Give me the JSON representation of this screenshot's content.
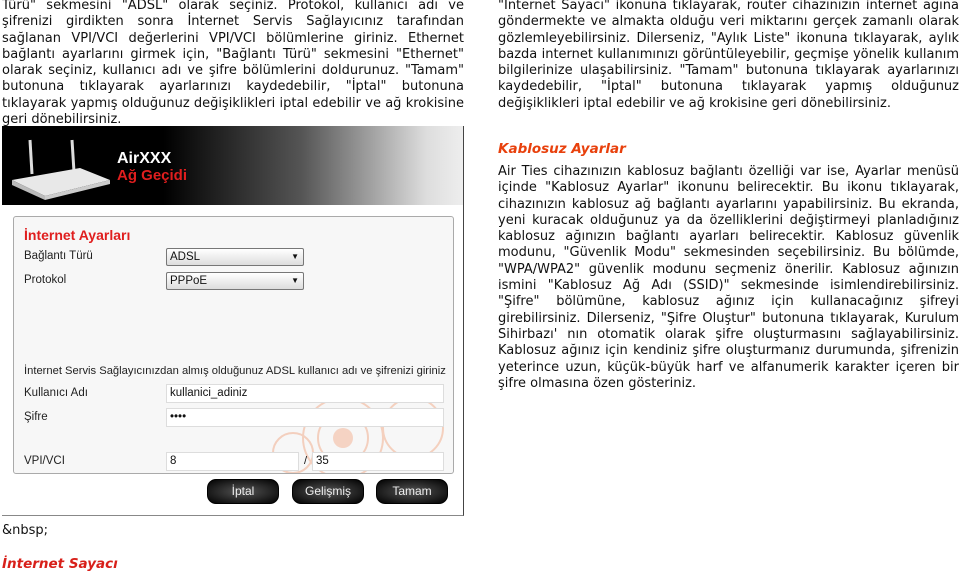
{
  "left_column": {
    "paragraph": "Türü\" sekmesini \"ADSL\" olarak seçiniz. Protokol, kullanıcı adı ve şifrenizi girdikten sonra İnternet Servis Sağlayıcınız tarafından sağlanan VPI/VCI değerlerini VPI/VCI bölümlerine giriniz. Ethernet bağlantı ayarlarını girmek için, \"Bağlantı Türü\" sekmesini \"Ethernet\" olarak seçiniz, kullanıcı adı ve şifre bölümlerini doldurunuz. \"Tamam\" butonuna tıklayarak ayarlarınızı kaydedebilir, \"İptal\" butonuna tıklayarak yapmış olduğunuz değişiklikleri iptal edebilir ve ağ krokisine geri dönebilirsiniz.",
    "nbsp_text": "&nbsp;",
    "section_heading": "İnternet Sayacı"
  },
  "screenshot": {
    "brand": "AirXXX",
    "brand_subtitle": "Ağ Geçidi",
    "panel_title": "İnternet Ayarları",
    "connection_type_label": "Bağlantı Türü",
    "connection_type_value": "ADSL",
    "protocol_label": "Protokol",
    "protocol_value": "PPPoE",
    "note": "İnternet Servis Sağlayıcınızdan almış olduğunuz ADSL kullanıcı adı ve şifrenizi giriniz",
    "username_label": "Kullanıcı Adı",
    "username_value": "kullanici_adiniz",
    "password_label": "Şifre",
    "password_value": "••••",
    "vpivci_label": "VPI/VCI",
    "vpi_value": "8",
    "separator": "/",
    "vci_value": "35",
    "buttons": {
      "cancel": "İptal",
      "advanced": "Gelişmiş",
      "ok": "Tamam"
    },
    "accent_color": "#e01e1e"
  },
  "right_column": {
    "paragraph1": "\"Internet Sayacı\" ikonuna tıklayarak, router cihazınızın internet ağına göndermekte ve almakta olduğu veri miktarını gerçek zamanlı olarak gözlemleyebilirsiniz. Dilerseniz, \"Aylık Liste\" ikonuna tıklayarak, aylık bazda internet kullanımınızı görüntüleyebilir, geçmişe yönelik kullanım bilgilerinize ulaşabilirsiniz. \"Tamam\" butonuna tıklayarak ayarlarınızı kaydedebilir, \"İptal\" butonuna tıklayarak yapmış olduğunuz değişiklikleri iptal edebilir ve ağ krokisine geri dönebilirsiniz.",
    "section_heading": "Kablosuz Ayarlar",
    "paragraph2": "Air Ties cihazınızın kablosuz bağlantı özelliği var ise, Ayarlar menüsü içinde \"Kablosuz Ayarlar\" ikonunu belirecektir. Bu ikonu tıklayarak, cihazınızın kablosuz ağ bağlantı ayarlarını yapabilirsiniz. Bu ekranda, yeni kuracak olduğunuz ya da özelliklerini değiştirmeyi planladığınız kablosuz ağınızın bağlantı ayarları belirecektir. Kablosuz güvenlik modunu, \"Güvenlik Modu\" sekmesinden seçebilirsiniz. Bu bölümde, \"WPA/WPA2\" güvenlik modunu seçmeniz önerilir. Kablosuz ağınızın ismini \"Kablosuz Ağ Adı (SSID)\" sekmesinde isimlendirebilirsiniz. \"Şifre\" bölümüne, kablosuz ağınız için kullanacağınız şifreyi girebilirsiniz. Dilerseniz, \"Şifre Oluştur\" butonuna tıklayarak, Kurulum Sihirbazı' nın otomatik olarak şifre oluşturmasını sağlayabilirsiniz. Kablosuz ağınız için kendiniz şifre oluşturmanız durumunda, şifrenizin yeterince uzun, küçük-büyük harf ve alfanumerik karakter içeren bir şifre olmasına özen gösteriniz."
  },
  "heading_color": "#e8400c"
}
